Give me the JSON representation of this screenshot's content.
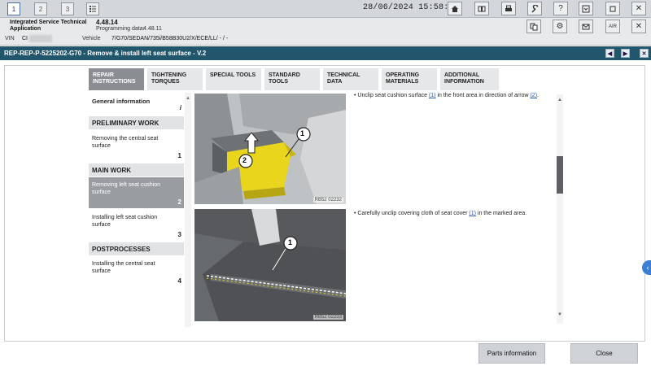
{
  "topbar": {
    "nav_buttons": [
      "1",
      "2",
      "3"
    ],
    "datetime": "28/06/2024 15:58:21"
  },
  "app": {
    "name_line1": "Integrated Service Technical",
    "name_line2": "Application",
    "version": "4.48.14",
    "programming_label": "Programming data:",
    "programming_value": "4.48.11",
    "vin_label": "VIN",
    "vin_value": "CI",
    "vehicle_label": "Vehicle",
    "vehicle_value": "7/G70/SEDAN/735i/B58B30U2/X/ECE/LL/ - / -"
  },
  "window": {
    "title": "REP-REP-P-5225202-G70 - Remove & install left seat surface - V.2"
  },
  "tabs": [
    {
      "label": "Repair instructions",
      "active": true
    },
    {
      "label": "Tightening torques",
      "active": false
    },
    {
      "label": "Special tools",
      "active": false
    },
    {
      "label": "Standard tools",
      "active": false
    },
    {
      "label": "Technical data",
      "active": false
    },
    {
      "label": "Operating materials",
      "active": false
    },
    {
      "label": "Additional information",
      "active": false
    }
  ],
  "sidebar": {
    "general_info": {
      "label": "General information",
      "num": "i"
    },
    "preliminary_header": "PRELIMINARY WORK",
    "item1": {
      "label": "Removing the central seat surface",
      "num": "1"
    },
    "main_header": "MAIN WORK",
    "item2": {
      "label": "Removing left seat cushion surface",
      "num": "2"
    },
    "item3": {
      "label": "Installing left seat cushion surface",
      "num": "3"
    },
    "post_header": "POSTPROCESSES",
    "item4": {
      "label": "Installing the central seat surface",
      "num": "4"
    }
  },
  "steps": {
    "step1": {
      "before": "Unclip seat cushion surface ",
      "ref1": "(1)",
      "mid": " in the front area in direction of arrow ",
      "ref2": "(2)",
      "after": "."
    },
    "step2": {
      "before": "Carefully unclip covering cloth of seat cover ",
      "ref1": "(1)",
      "after": " in the marked area."
    }
  },
  "images": {
    "img1_code": "RB52 02232",
    "img2_code": "RB52 02233",
    "callout_1": "1",
    "callout_2": "2"
  },
  "buttons": {
    "parts_info": "Parts information",
    "close": "Close"
  },
  "colors": {
    "titlebar": "#21566c",
    "active_tab": "#8a8e93",
    "seat_yellow": "#e8d51c"
  }
}
